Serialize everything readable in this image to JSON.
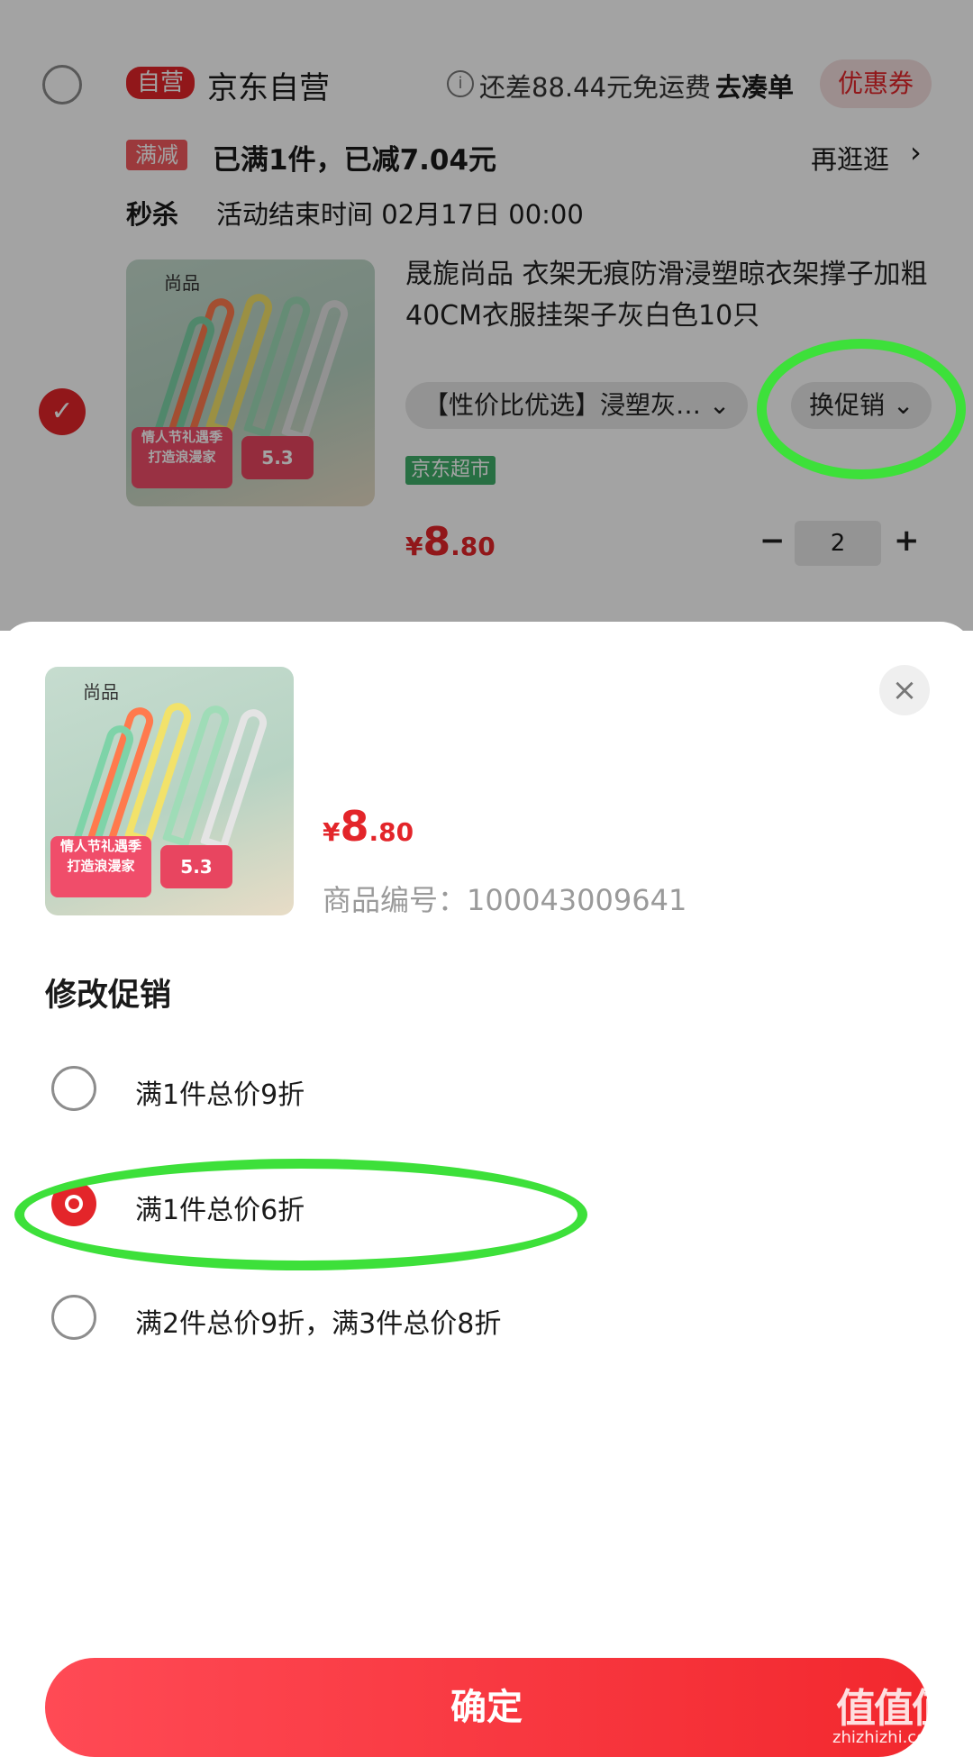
{
  "store": {
    "badge": "自营",
    "name": "京东自营",
    "shipping_note": "还差88.44元免运费",
    "add_items": "去凑单",
    "coupon": "优惠券"
  },
  "promo_line": {
    "badge": "满减",
    "text": "已满1件，已减7.04元",
    "browse": "再逛逛"
  },
  "flash_sale": {
    "label": "秒杀",
    "end_time": "活动结束时间 02月17日 00:00"
  },
  "product": {
    "title": "晟旎尚品 衣架无痕防滑浸塑晾衣架撑子加粗40CM衣服挂架子灰白色10只",
    "variant": "【性价比优选】浸塑灰…",
    "change_promo": "换促销",
    "store_tag": "京东超市",
    "price_symbol": "¥",
    "price_int": "8",
    "price_dec": ".80",
    "quantity": "2",
    "thumb_brand": "尚品",
    "thumb_promo_line1": "情人节礼遇季",
    "thumb_promo_line2": "打造浪漫家",
    "thumb_date": "5.3"
  },
  "sheet": {
    "price_symbol": "¥",
    "price_int": "8",
    "price_dec": ".80",
    "product_code": "商品编号：100043009641",
    "section_title": "修改促销",
    "options": [
      {
        "label": "满1件总价9折",
        "selected": false
      },
      {
        "label": "满1件总价6折",
        "selected": true
      },
      {
        "label": "满2件总价9折，满3件总价8折",
        "selected": false
      }
    ],
    "confirm": "确定"
  },
  "watermark": {
    "logo": "值值值",
    "site": "zhizhizhi.com"
  },
  "colors": {
    "accent": "#e3252a",
    "annotation": "#3de03a"
  }
}
